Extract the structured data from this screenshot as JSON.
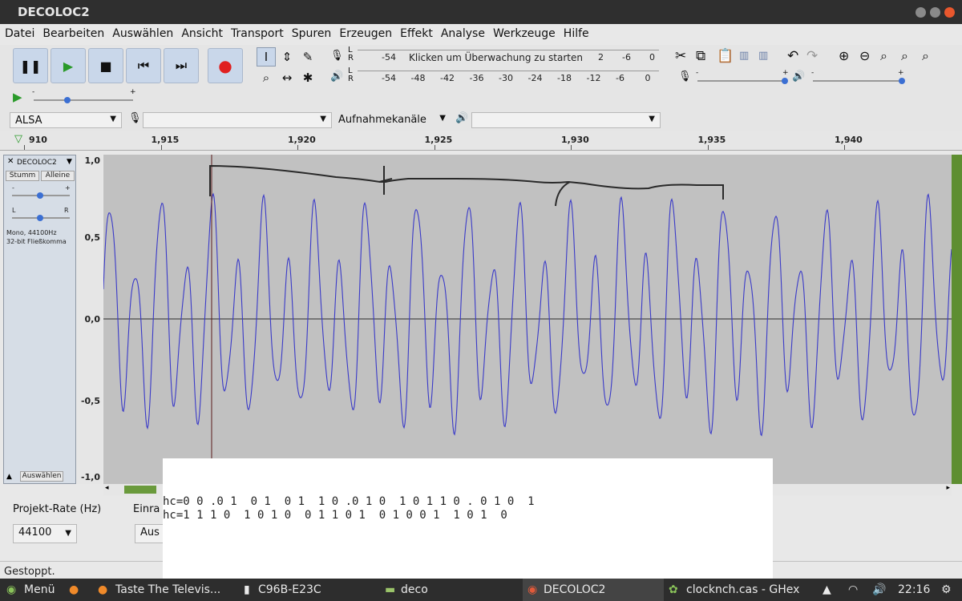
{
  "window": {
    "title": "DECOLOC2"
  },
  "menu": [
    "Datei",
    "Bearbeiten",
    "Auswählen",
    "Ansicht",
    "Transport",
    "Spuren",
    "Erzeugen",
    "Effekt",
    "Analyse",
    "Werkzeuge",
    "Hilfe"
  ],
  "transport": {
    "icons": [
      "pause-icon",
      "play-icon",
      "stop-icon",
      "skip-start-icon",
      "skip-end-icon",
      "record-icon"
    ]
  },
  "meters": {
    "record": {
      "channels": "L R",
      "left": "-54",
      "prompt": "Klicken um Überwachung zu starten",
      "ticks": [
        "2",
        "-6",
        "0"
      ]
    },
    "playback": {
      "channels": "L R",
      "ticks": [
        "-54",
        "-48",
        "-42",
        "-36",
        "-30",
        "-24",
        "-18",
        "-12",
        "-6",
        "0"
      ]
    }
  },
  "slider_signs": {
    "minus": "-",
    "plus": "+"
  },
  "devices": {
    "host": "ALSA",
    "channels": "Aufnahmekanäle"
  },
  "ruler": {
    "labels": [
      "910",
      "1,915",
      "1,920",
      "1,925",
      "1,930",
      "1,935",
      "1,940"
    ]
  },
  "track": {
    "name": "DECOLOC2",
    "mute": "Stumm",
    "solo": "Alleine",
    "gain_minus": "-",
    "gain_plus": "+",
    "pan_left": "L",
    "pan_right": "R",
    "info_line1": "Mono, 44100Hz",
    "info_line2": "32-bit Fließkomma",
    "select": "Auswählen",
    "scale": [
      "1,0",
      "0,5",
      "0,0",
      "-0,5",
      "-1,0"
    ]
  },
  "bottom": {
    "rate_label": "Projekt-Rate (Hz)",
    "rate_value": "44100",
    "snap_label": "Einra",
    "snap_value": "Aus"
  },
  "status": "Gestoppt.",
  "notes": {
    "line1": "hc=0 0 .0 1  0 1  0 1  1 0 .0 1 0  1 0 1 1 0 . 0 1 0  1",
    "line2": "hc=1 1 1 0  1 0 1 0  0 1 1 0 1  0 1 0 0 1  1 0 1  0"
  },
  "taskbar": {
    "menu": "Menü",
    "items": [
      "Taste The Televis...",
      "C96B-E23C",
      "deco",
      "DECOLOC2",
      "clocknch.cas - GHex"
    ],
    "time": "22:16"
  }
}
